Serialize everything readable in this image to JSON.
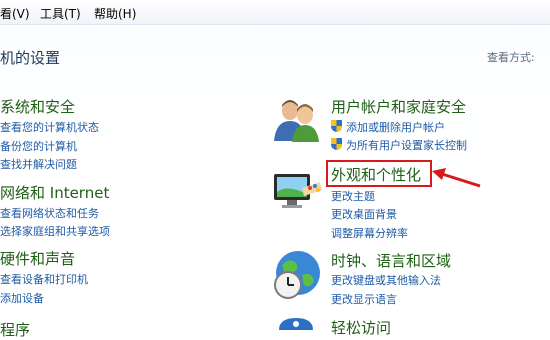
{
  "menu": {
    "view": "看(V)",
    "tools": "工具(T)",
    "help": "帮助(H)"
  },
  "page": {
    "title": "机的设置",
    "view_by": "查看方式:"
  },
  "left": [
    {
      "title": "系统和安全",
      "links": [
        "查看您的计算机状态",
        "备份您的计算机",
        "查找并解决问题"
      ]
    },
    {
      "title": "网络和 Internet",
      "links": [
        "查看网络状态和任务",
        "选择家庭组和共享选项"
      ]
    },
    {
      "title": "硬件和声音",
      "links": [
        "查看设备和打印机",
        "添加设备"
      ]
    },
    {
      "title": "程序"
    }
  ],
  "right": [
    {
      "title": "用户帐户和家庭安全",
      "links": [
        "添加或删除用户帐户",
        "为所有用户设置家长控制"
      ]
    },
    {
      "title": "外观和个性化",
      "links": [
        "更改主题",
        "更改桌面背景",
        "调整屏幕分辨率"
      ]
    },
    {
      "title": "时钟、语言和区域",
      "links": [
        "更改键盘或其他输入法",
        "更改显示语言"
      ]
    },
    {
      "title": "轻松访问"
    }
  ],
  "colors": {
    "category": "#1f5f16",
    "link": "#1f5ba6",
    "highlight": "#d7191c"
  },
  "icons": {
    "user_accounts": "users-icon",
    "appearance": "monitor-palette-icon",
    "clock": "globe-clock-icon",
    "ease": "ease-of-access-icon",
    "shield": "shield-icon"
  }
}
